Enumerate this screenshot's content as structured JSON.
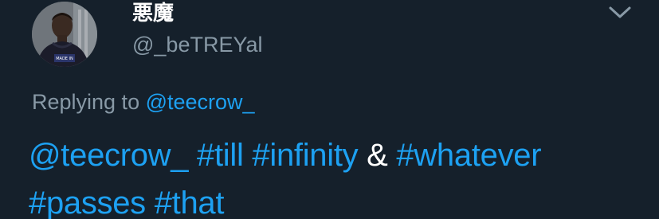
{
  "tweet": {
    "display_name": "悪魔",
    "handle": "@_beTREYal",
    "replying_prefix": "Replying to",
    "replying_to": "@teecrow_",
    "body": {
      "mention": "@teecrow_",
      "hashtag_1": "#till",
      "hashtag_2": "#infinity",
      "connector": "&",
      "hashtag_3": "#whatever",
      "hashtag_4": "#passes",
      "hashtag_5": "#that"
    },
    "avatar_shirt_text": "MADE IN"
  },
  "icons": {
    "menu": "chevron-down-icon",
    "avatar": "avatar"
  },
  "colors": {
    "background": "#15202b",
    "link": "#1da1f2",
    "secondary_text": "#8899a6",
    "primary_text": "#ffffff"
  }
}
